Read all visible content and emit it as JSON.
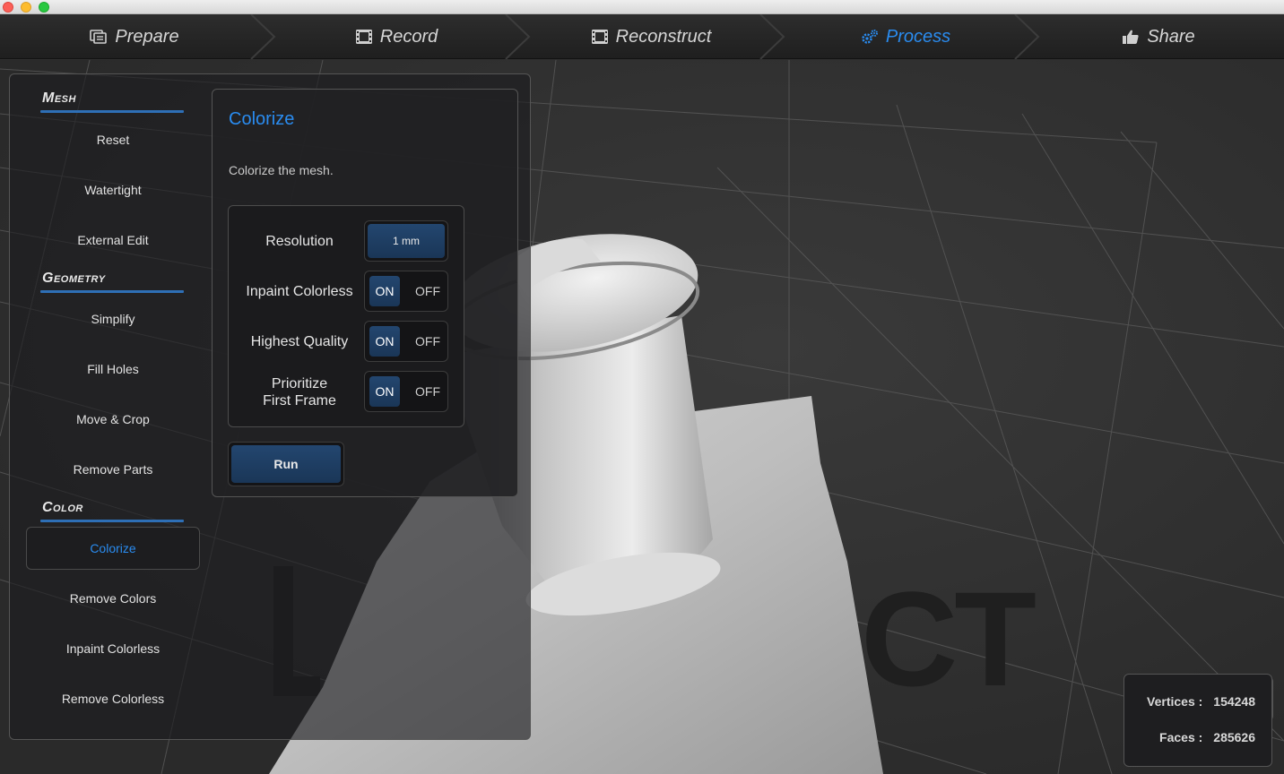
{
  "window": {
    "colors": {
      "accent": "#2a8cf0",
      "button_fill": "#1f3d62",
      "panel_bg": "#1c1c1e"
    }
  },
  "tabs": [
    {
      "label": "Prepare",
      "icon": "prepare-icon",
      "active": false
    },
    {
      "label": "Record",
      "icon": "film-icon",
      "active": false
    },
    {
      "label": "Reconstruct",
      "icon": "film-icon",
      "active": false
    },
    {
      "label": "Process",
      "icon": "gears-icon",
      "active": true
    },
    {
      "label": "Share",
      "icon": "thumbs-up-icon",
      "active": false
    }
  ],
  "sidebar": {
    "sections": [
      {
        "title": "Mesh",
        "items": [
          "Reset",
          "Watertight",
          "External Edit"
        ]
      },
      {
        "title": "Geometry",
        "items": [
          "Simplify",
          "Fill Holes",
          "Move & Crop",
          "Remove Parts"
        ]
      },
      {
        "title": "Color",
        "items": [
          "Colorize",
          "Remove Colors",
          "Inpaint Colorless",
          "Remove Colorless"
        ]
      }
    ],
    "selected": "Colorize"
  },
  "colorize": {
    "title": "Colorize",
    "description": "Colorize the mesh.",
    "resolution_label": "Resolution",
    "resolution_value": "1 mm",
    "inpaint_label": "Inpaint Colorless",
    "highest_quality_label": "Highest Quality",
    "prioritize_line1": "Prioritize",
    "prioritize_line2": "First Frame",
    "on_label": "ON",
    "off_label": "OFF",
    "inpaint_state": "ON",
    "highest_quality_state": "ON",
    "prioritize_state": "ON",
    "run_label": "Run"
  },
  "viewport": {
    "watermark_text": "CT"
  },
  "stats": {
    "vertices_label": "Vertices :",
    "vertices_value": "154248",
    "faces_label": "Faces :",
    "faces_value": "285626"
  }
}
